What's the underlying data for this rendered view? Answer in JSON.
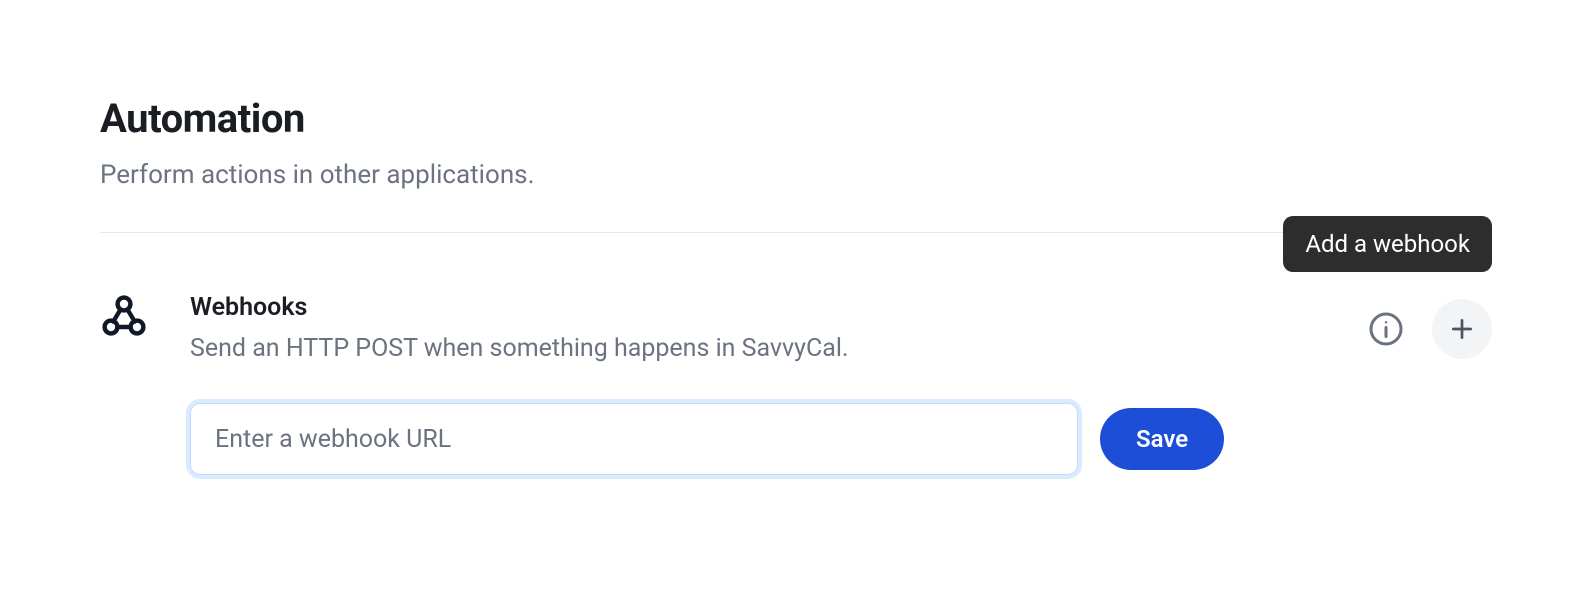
{
  "header": {
    "title": "Automation",
    "subtitle": "Perform actions in other applications."
  },
  "section": {
    "title": "Webhooks",
    "description": "Send an HTTP POST when something happens in SavvyCal.",
    "input": {
      "value": "",
      "placeholder": "Enter a webhook URL"
    },
    "save_label": "Save"
  },
  "tooltip": {
    "text": "Add a webhook"
  }
}
